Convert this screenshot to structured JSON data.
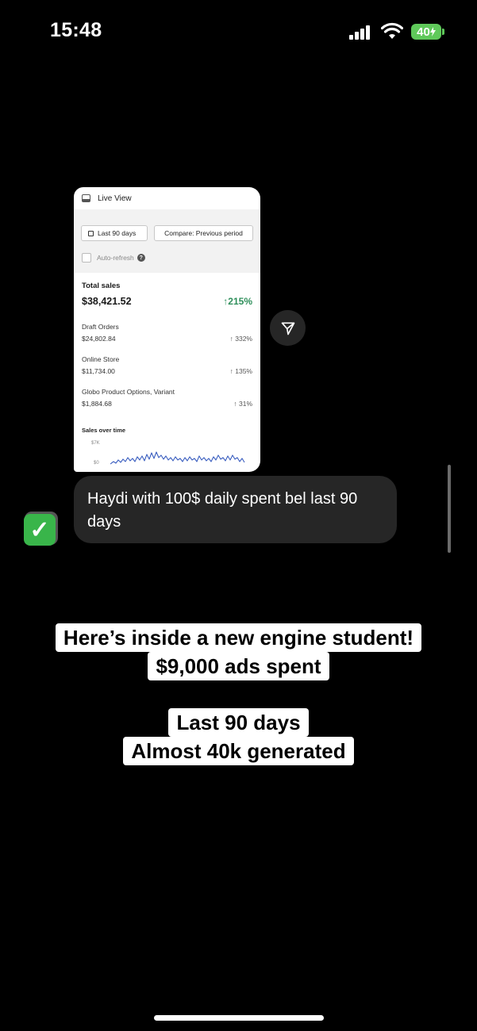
{
  "status_bar": {
    "time": "15:48",
    "battery": "40"
  },
  "shared_post": {
    "header": "Live View",
    "date_filter": "Last 90 days",
    "compare": "Compare: Previous period",
    "auto_refresh": "Auto-refresh",
    "total": {
      "label": "Total sales",
      "value": "$38,421.52",
      "change": "215%"
    },
    "rows": [
      {
        "label": "Draft Orders",
        "value": "$24,802.84",
        "change": "332%"
      },
      {
        "label": "Online Store",
        "value": "$11,734.00",
        "change": "135%"
      },
      {
        "label": "Globo Product Options, Variant",
        "value": "$1,884.68",
        "change": "31%"
      }
    ],
    "chart_title": "Sales over time",
    "y_top": "$7K",
    "y_bottom": "$0"
  },
  "message": {
    "text": "Haydi with 100$ daily spent bel last 90 days"
  },
  "reaction": {
    "emoji": "✓"
  },
  "captions": {
    "line1": "Here’s inside a new engine student!",
    "line2": "$9,000 ads spent",
    "line3": "Last 90 days",
    "line4": "Almost 40k generated"
  },
  "icons": {
    "share": "send-icon",
    "check": "check-mark-icon"
  }
}
